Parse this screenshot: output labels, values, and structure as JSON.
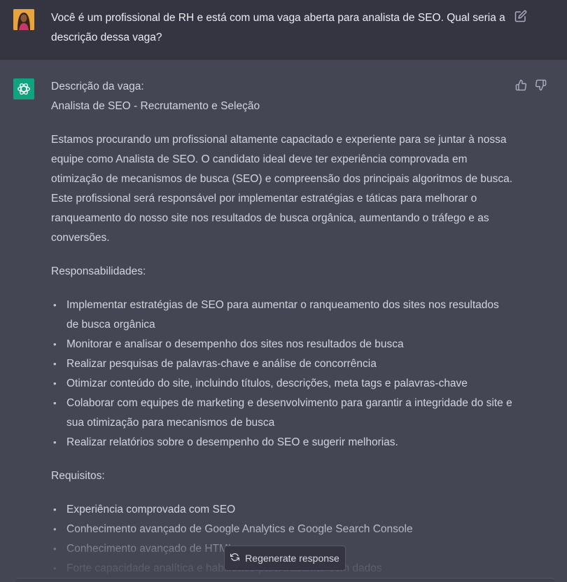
{
  "user_message": {
    "text": "Você é um profissional de RH e está com uma vaga aberta para analista de SEO. Qual seria a descrição dessa vaga?",
    "edit_icon": "pencil-square-icon"
  },
  "assistant_message": {
    "intro_line_1": "Descrição da vaga:",
    "intro_line_2": "Analista de SEO - Recrutamento e Seleção",
    "paragraph": "Estamos procurando um profissional altamente capacitado e experiente para se juntar à nossa equipe como Analista de SEO. O candidato ideal deve ter experiência comprovada em otimização de mecanismos de busca (SEO) e compreensão dos principais algoritmos de busca. Este profissional será responsável por implementar estratégias e táticas para melhorar o ranqueamento do nosso site nos resultados de busca orgânica, aumentando o tráfego e as conversões.",
    "responsibilities_heading": "Responsabilidades:",
    "responsibilities": [
      "Implementar estratégias de SEO para aumentar o ranqueamento dos sites nos resultados de busca orgânica",
      "Monitorar e analisar o desempenho dos sites nos resultados de busca",
      "Realizar pesquisas de palavras-chave e análise de concorrência",
      "Otimizar conteúdo do site, incluindo títulos, descrições, meta tags e palavras-chave",
      "Colaborar com equipes de marketing e desenvolvimento para garantir a integridade do site e sua otimização para mecanismos de busca",
      "Realizar relatórios sobre o desempenho do SEO e sugerir melhorias."
    ],
    "requirements_heading": "Requisitos:",
    "requirements": [
      "Experiência comprovada com SEO",
      "Conhecimento avançado de Google Analytics e Google Search Console",
      "Conhecimento avançado de HTML",
      "Forte capacidade analítica e habilidade para trabalhar com dados"
    ],
    "feedback_icons": [
      "thumbs-up-icon",
      "thumbs-down-icon"
    ]
  },
  "regenerate_button": {
    "label": "Regenerate response",
    "icon": "refresh-icon"
  },
  "colors": {
    "user_bg": "#343541",
    "assistant_bg": "#444654",
    "gpt_brand": "#10a37f"
  }
}
